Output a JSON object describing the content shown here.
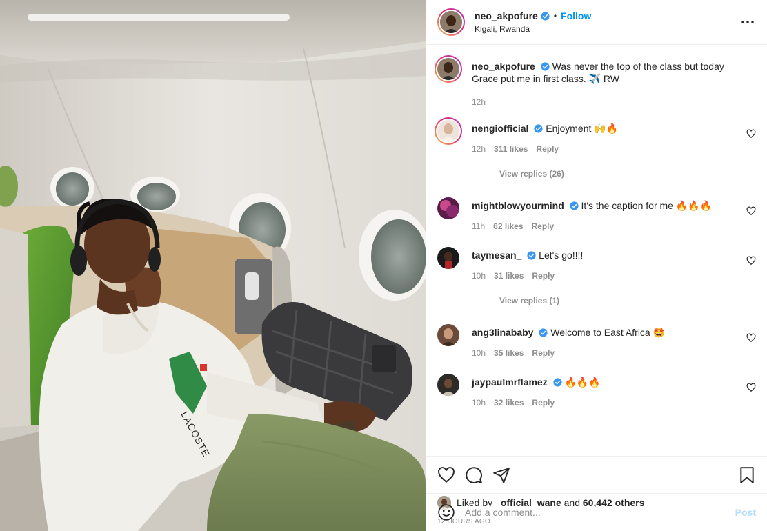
{
  "author": {
    "username": "neo_akpofure",
    "follow_label": "Follow",
    "separator": "•",
    "location": "Kigali, Rwanda"
  },
  "caption": {
    "username": "neo_akpofure",
    "text": "Was never the top of the class but today Grace put me in first class. ✈️ RW",
    "time": "12h"
  },
  "comments": [
    {
      "username": "nengiofficial",
      "text": "Enjoyment 🙌🔥",
      "time": "12h",
      "likes": "311 likes",
      "reply": "Reply",
      "view_replies": "View replies (26)"
    },
    {
      "username": "mightblowyourmind",
      "text": "It's the caption for me 🔥🔥🔥",
      "time": "11h",
      "likes": "62 likes",
      "reply": "Reply"
    },
    {
      "username": "taymesan_",
      "text": "Let's go!!!!",
      "time": "10h",
      "likes": "31 likes",
      "reply": "Reply",
      "view_replies": "View replies (1)"
    },
    {
      "username": "ang3linababy",
      "text": "Welcome to East Africa 🤩",
      "time": "10h",
      "likes": "35 likes",
      "reply": "Reply"
    },
    {
      "username": "jaypaulmrflamez",
      "text": "🔥🔥🔥",
      "time": "10h",
      "likes": "32 likes",
      "reply": "Reply"
    }
  ],
  "likes": {
    "prefix": "Liked by",
    "first_user": "_official_wane",
    "conjunction": "and",
    "others": "60,442 others"
  },
  "timestamp": "12 HOURS AGO",
  "add_comment": {
    "placeholder": "Add a comment...",
    "post_label": "Post"
  },
  "icons": {
    "verified": "verified-badge-icon",
    "more": "more-options-icon",
    "like": "heart-icon",
    "comment": "comment-icon",
    "share": "paper-plane-icon",
    "save": "bookmark-icon",
    "emoji": "smiley-icon"
  },
  "colors": {
    "accent": "#0095f6",
    "verified": "#3897f0",
    "muted": "#8e8e8e",
    "post_disabled": "#b2dffc"
  }
}
